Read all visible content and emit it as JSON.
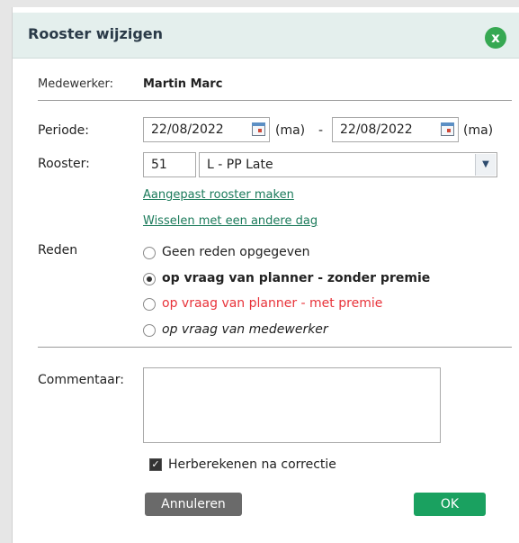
{
  "dialog": {
    "title": "Rooster wijzigen",
    "close_icon": "x"
  },
  "employee": {
    "label": "Medewerker:",
    "name": "Martin Marc"
  },
  "period": {
    "label": "Periode:",
    "start_date": "22/08/2022",
    "start_day": "(ma)",
    "separator": "-",
    "end_date": "22/08/2022",
    "end_day": "(ma)"
  },
  "schedule": {
    "label": "Rooster:",
    "code": "51",
    "selected": "L - PP Late"
  },
  "links": {
    "custom_schedule": "Aangepast rooster maken",
    "swap_day": "Wisselen met een andere dag"
  },
  "reason": {
    "label": "Reden",
    "options": [
      {
        "label": "Geen reden opgegeven"
      },
      {
        "label": "op vraag van planner - zonder premie"
      },
      {
        "label": "op vraag van planner - met premie"
      },
      {
        "label": "op vraag van medewerker"
      }
    ],
    "selected_index": 1
  },
  "comment": {
    "label": "Commentaar:",
    "value": ""
  },
  "recalc": {
    "label": "Herberekenen na correctie",
    "checked": true
  },
  "buttons": {
    "cancel": "Annuleren",
    "ok": "OK"
  },
  "colors": {
    "header_bg": "#e4efed",
    "accent_green": "#1aa160",
    "link": "#1a7a5a",
    "premium_red": "#e8333a"
  }
}
